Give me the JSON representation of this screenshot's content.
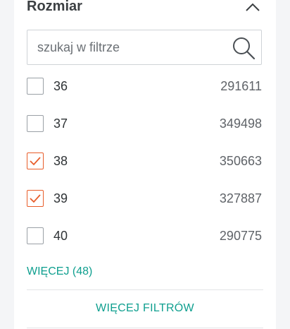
{
  "filter": {
    "title": "Rozmiar",
    "collapse_icon": "chevron-up-icon",
    "search": {
      "placeholder": "szukaj w filtrze",
      "value": "",
      "icon": "search-icon"
    },
    "options": [
      {
        "label": "36",
        "count": "291611",
        "checked": false
      },
      {
        "label": "37",
        "count": "349498",
        "checked": false
      },
      {
        "label": "38",
        "count": "350663",
        "checked": true
      },
      {
        "label": "39",
        "count": "327887",
        "checked": true
      },
      {
        "label": "40",
        "count": "290775",
        "checked": false
      }
    ],
    "more_label": "WIĘCEJ (48)"
  },
  "more_filters_label": "WIĘCEJ FILTRÓW",
  "colors": {
    "accent": "#0f9f8f",
    "checked": "#e85d2a",
    "text": "#2f3336"
  }
}
